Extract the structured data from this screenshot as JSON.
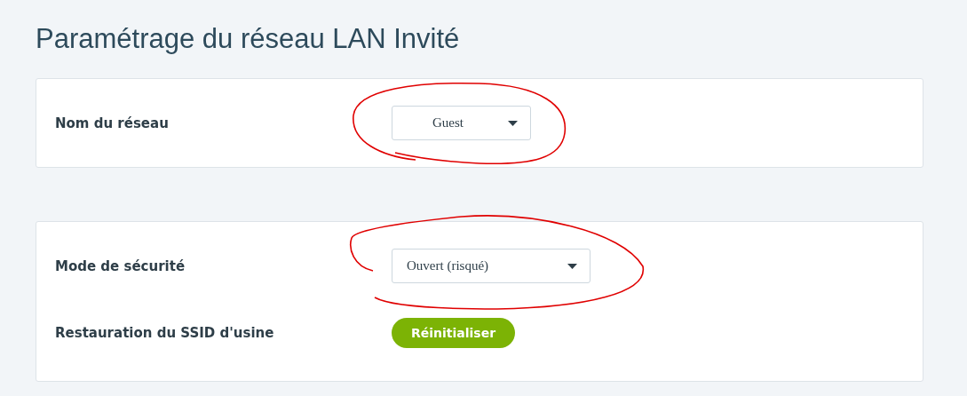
{
  "title": "Paramétrage du réseau LAN Invité",
  "cards": [
    {
      "rows": [
        {
          "kind": "select",
          "label": "Nom du réseau",
          "value": "Guest"
        }
      ]
    },
    {
      "rows": [
        {
          "kind": "select",
          "label": "Mode de sécurité",
          "value": "Ouvert (risqué)"
        },
        {
          "kind": "button",
          "label": "Restauration du SSID d'usine",
          "button": "Réinitialiser"
        }
      ]
    }
  ],
  "annotations": [
    {
      "kind": "circle"
    },
    {
      "kind": "circle"
    }
  ]
}
